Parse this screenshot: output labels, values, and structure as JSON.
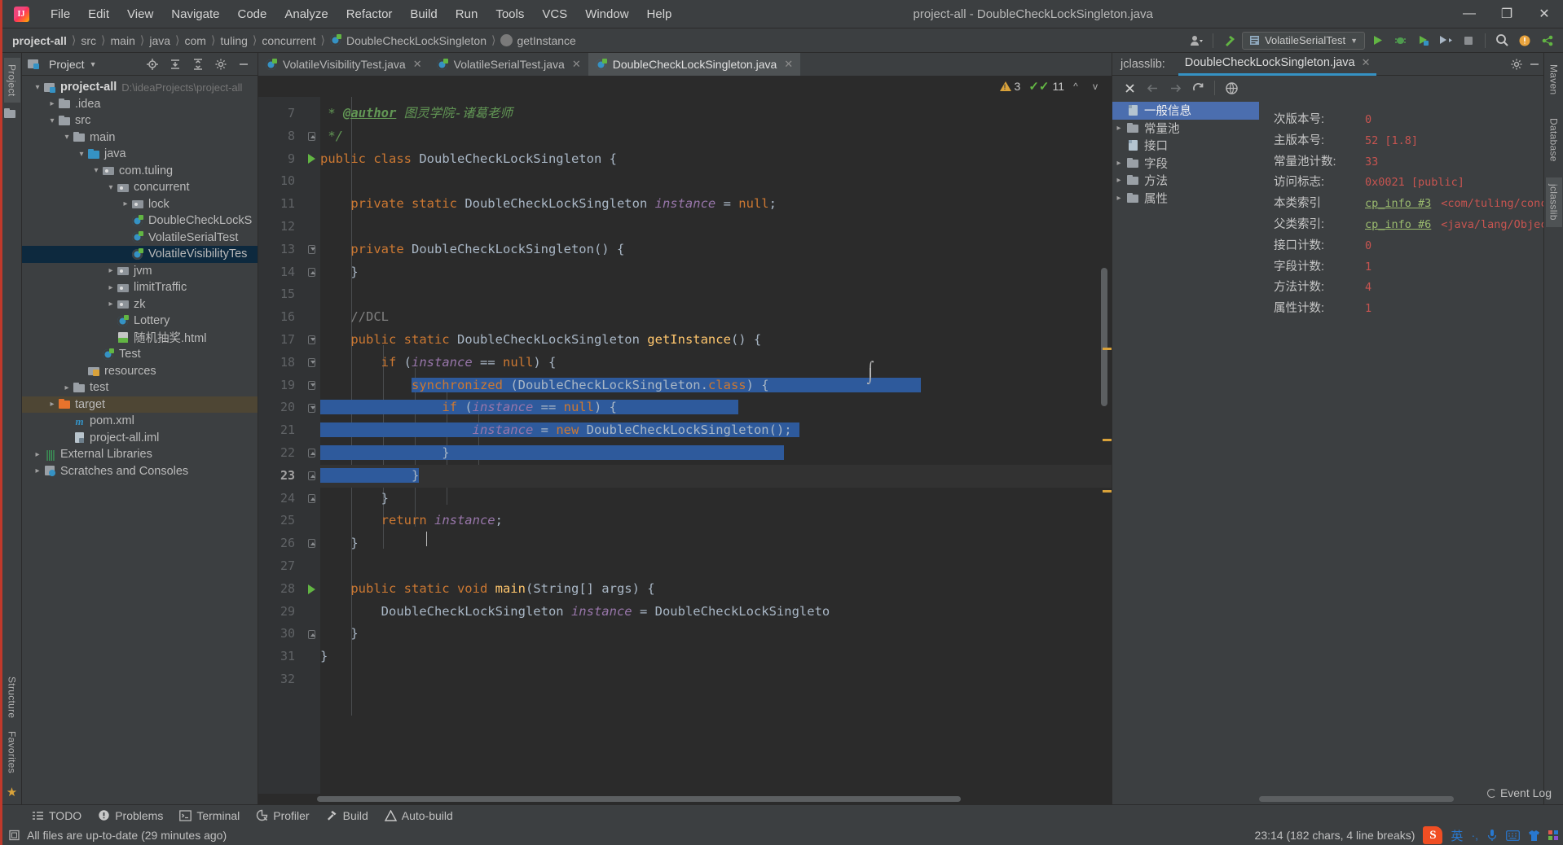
{
  "window": {
    "title": "project-all - DoubleCheckLockSingleton.java",
    "logo_text": "IJ",
    "minimize": "—",
    "maximize": "❐",
    "close": "✕"
  },
  "menubar": [
    "File",
    "Edit",
    "View",
    "Navigate",
    "Code",
    "Analyze",
    "Refactor",
    "Build",
    "Run",
    "Tools",
    "VCS",
    "Window",
    "Help"
  ],
  "breadcrumb": [
    "project-all",
    "src",
    "main",
    "java",
    "com",
    "tuling",
    "concurrent",
    "DoubleCheckLockSingleton",
    "getInstance"
  ],
  "toolbar": {
    "run_config": "VolatileSerialTest",
    "run_icon": "run-icon",
    "debug_icon": "debug-icon",
    "coverage_icon": "coverage-icon",
    "profile_icon": "profile-icon",
    "stop_icon": "stop-icon",
    "search_icon": "search-icon",
    "updates_icon": "updates-icon",
    "share_icon": "share-icon",
    "account_icon": "account-icon",
    "build_icon": "build-hammer-icon"
  },
  "left_strip": {
    "tabs": [
      "Project",
      "Structure",
      "Favorites"
    ]
  },
  "right_strip": {
    "tabs": [
      "Maven",
      "Database",
      "jclasslib"
    ]
  },
  "project_panel": {
    "title": "Project",
    "buttons": [
      "locate-icon",
      "expand-all-icon",
      "collapse-all-icon",
      "settings-icon",
      "hide-icon"
    ],
    "tree": [
      {
        "indent": 0,
        "arrow": "v",
        "icon": "project-icon",
        "label": "project-all",
        "bold": true,
        "path": "D:\\ideaProjects\\project-all"
      },
      {
        "indent": 1,
        "arrow": ">",
        "icon": "folder-icon",
        "label": ".idea"
      },
      {
        "indent": 1,
        "arrow": "v",
        "icon": "folder-icon",
        "label": "src"
      },
      {
        "indent": 2,
        "arrow": "v",
        "icon": "folder-icon",
        "label": "main"
      },
      {
        "indent": 3,
        "arrow": "v",
        "icon": "folder-blue-icon",
        "label": "java"
      },
      {
        "indent": 4,
        "arrow": "v",
        "icon": "package-icon",
        "label": "com.tuling"
      },
      {
        "indent": 5,
        "arrow": "v",
        "icon": "package-icon",
        "label": "concurrent"
      },
      {
        "indent": 6,
        "arrow": ">",
        "icon": "package-icon",
        "label": "lock"
      },
      {
        "indent": 6,
        "arrow": "",
        "icon": "java-class-icon",
        "label": "DoubleCheckLockS"
      },
      {
        "indent": 6,
        "arrow": "",
        "icon": "java-class-icon",
        "label": "VolatileSerialTest"
      },
      {
        "indent": 6,
        "arrow": "",
        "icon": "java-class-icon",
        "label": "VolatileVisibilityTes",
        "selected": true
      },
      {
        "indent": 5,
        "arrow": ">",
        "icon": "package-icon",
        "label": "jvm"
      },
      {
        "indent": 5,
        "arrow": ">",
        "icon": "package-icon",
        "label": "limitTraffic"
      },
      {
        "indent": 5,
        "arrow": ">",
        "icon": "package-icon",
        "label": "zk"
      },
      {
        "indent": 5,
        "arrow": "",
        "icon": "java-class-icon",
        "label": "Lottery"
      },
      {
        "indent": 5,
        "arrow": "",
        "icon": "html-icon",
        "label": "随机抽奖.html"
      },
      {
        "indent": 4,
        "arrow": "",
        "icon": "java-class-icon",
        "label": "Test"
      },
      {
        "indent": 3,
        "arrow": "",
        "icon": "resources-icon",
        "label": "resources"
      },
      {
        "indent": 2,
        "arrow": ">",
        "icon": "folder-icon",
        "label": "test"
      },
      {
        "indent": 1,
        "arrow": ">",
        "icon": "folder-orange-icon",
        "label": "target",
        "highlight": true
      },
      {
        "indent": 2,
        "arrow": "",
        "icon": "maven-icon",
        "label": "pom.xml"
      },
      {
        "indent": 2,
        "arrow": "",
        "icon": "iml-icon",
        "label": "project-all.iml"
      },
      {
        "indent": 0,
        "arrow": ">",
        "icon": "library-icon",
        "label": "External Libraries"
      },
      {
        "indent": 0,
        "arrow": ">",
        "icon": "scratch-icon",
        "label": "Scratches and Consoles"
      }
    ]
  },
  "editor": {
    "tabs": [
      {
        "label": "VolatileVisibilityTest.java",
        "active": false,
        "close": "✕"
      },
      {
        "label": "VolatileSerialTest.java",
        "active": false,
        "close": "✕"
      },
      {
        "label": "DoubleCheckLockSingleton.java",
        "active": true,
        "close": "✕"
      }
    ],
    "inspections": {
      "warning_icon": "warning-triangle-icon",
      "warning_count": "3",
      "check_icon": "double-check-icon",
      "check_count": "11",
      "prev_icon": "^",
      "next_icon": "v"
    },
    "first_line_number": 7,
    "current_line": 23,
    "lines": [
      {
        "n": 7,
        "fold": "",
        "run": false
      },
      {
        "n": 8,
        "fold": "up",
        "run": false
      },
      {
        "n": 9,
        "fold": "",
        "run": true
      },
      {
        "n": 10,
        "fold": "",
        "run": false
      },
      {
        "n": 11,
        "fold": "",
        "run": false
      },
      {
        "n": 12,
        "fold": "",
        "run": false
      },
      {
        "n": 13,
        "fold": "down",
        "run": false
      },
      {
        "n": 14,
        "fold": "up",
        "run": false
      },
      {
        "n": 15,
        "fold": "",
        "run": false
      },
      {
        "n": 16,
        "fold": "",
        "run": false
      },
      {
        "n": 17,
        "fold": "down",
        "run": false
      },
      {
        "n": 18,
        "fold": "down",
        "run": false
      },
      {
        "n": 19,
        "fold": "down",
        "run": false
      },
      {
        "n": 20,
        "fold": "down",
        "run": false
      },
      {
        "n": 21,
        "fold": "",
        "run": false
      },
      {
        "n": 22,
        "fold": "up",
        "run": false
      },
      {
        "n": 23,
        "fold": "up",
        "run": false
      },
      {
        "n": 24,
        "fold": "up",
        "run": false
      },
      {
        "n": 25,
        "fold": "",
        "run": false
      },
      {
        "n": 26,
        "fold": "up",
        "run": false
      },
      {
        "n": 27,
        "fold": "",
        "run": false
      },
      {
        "n": 28,
        "fold": "",
        "run": true
      },
      {
        "n": 29,
        "fold": "",
        "run": false
      },
      {
        "n": 30,
        "fold": "up",
        "run": false
      },
      {
        "n": 31,
        "fold": "",
        "run": false
      },
      {
        "n": 32,
        "fold": "",
        "run": false
      }
    ],
    "code_text": [
      " * @author 图灵学院-诸葛老师",
      " */",
      "public class DoubleCheckLockSingleton {",
      "",
      "    private static DoubleCheckLockSingleton instance = null;",
      "",
      "    private DoubleCheckLockSingleton() {",
      "    }",
      "",
      "    //DCL",
      "    public static DoubleCheckLockSingleton getInstance() {",
      "        if (instance == null) {",
      "            synchronized (DoubleCheckLockSingleton.class) {",
      "                if (instance == null) {",
      "                    instance = new DoubleCheckLockSingleton();",
      "                }",
      "            }",
      "        }",
      "        return instance;",
      "    }",
      "",
      "    public static void main(String[] args) {",
      "        DoubleCheckLockSingleton instance = DoubleCheckLockSingleto",
      "    }",
      "}",
      ""
    ]
  },
  "jclasslib": {
    "prefix_label": "jclasslib:",
    "tab_label": "DoubleCheckLockSingleton.java",
    "tab_close": "✕",
    "settings_icon": "gear-icon",
    "hide_icon": "hide-icon",
    "toolbar": [
      "close-icon",
      "back-arrow-icon",
      "forward-arrow-icon",
      "reload-icon",
      "browse-icon"
    ],
    "tree": [
      {
        "arrow": "",
        "icon": "doc-icon",
        "label": "一般信息",
        "selected": true
      },
      {
        "arrow": ">",
        "icon": "folder-icon",
        "label": "常量池"
      },
      {
        "arrow": "",
        "icon": "doc-icon",
        "label": "接口"
      },
      {
        "arrow": ">",
        "icon": "folder-icon",
        "label": "字段"
      },
      {
        "arrow": ">",
        "icon": "folder-icon",
        "label": "方法"
      },
      {
        "arrow": ">",
        "icon": "folder-icon",
        "label": "属性"
      }
    ],
    "details": [
      {
        "key": "次版本号:",
        "value": "0"
      },
      {
        "key": "主版本号:",
        "value": "52 [1.8]"
      },
      {
        "key": "常量池计数:",
        "value": "33"
      },
      {
        "key": "访问标志:",
        "value": "0x0021 [public]"
      },
      {
        "key": "本类索引",
        "link": "cp_info #3",
        "value": "<com/tuling/concurrent/Double"
      },
      {
        "key": "父类索引:",
        "link": "cp_info #6",
        "value": "<java/lang/Object>"
      },
      {
        "key": "接口计数:",
        "value": "0"
      },
      {
        "key": "字段计数:",
        "value": "1"
      },
      {
        "key": "方法计数:",
        "value": "4"
      },
      {
        "key": "属性计数:",
        "value": "1"
      }
    ]
  },
  "bottom_bar": [
    {
      "icon": "todo-icon",
      "label": "TODO"
    },
    {
      "icon": "problems-icon",
      "label": "Problems"
    },
    {
      "icon": "terminal-icon",
      "label": "Terminal"
    },
    {
      "icon": "profiler-icon",
      "label": "Profiler"
    },
    {
      "icon": "build-icon",
      "label": "Build"
    },
    {
      "icon": "auto-build-icon",
      "label": "Auto-build"
    }
  ],
  "statusbar": {
    "message_icon": "notification-icon",
    "message": "All files are up-to-date (29 minutes ago)",
    "caret_position": "23:14 (182 chars, 4 line breaks)",
    "event_log": "Event Log",
    "ime": {
      "sogou": "S",
      "mode": "英",
      "punct": "·,",
      "voice_icon": "microphone-icon",
      "keyboard_icon": "keyboard-icon",
      "skin_icon": "tshirt-icon",
      "apps_icon": "apps-icon"
    }
  },
  "colors": {
    "accent": "#3592c4",
    "selection": "#2e5a9c",
    "tree_selection": "#0d293e",
    "keyword": "#cc7832",
    "field": "#9876aa",
    "method": "#ffc66d",
    "comment": "#808080",
    "javadoc": "#629755",
    "value_red": "#c75450",
    "link_green": "#9aba6e",
    "warning": "#d9a23a",
    "ok_green": "#62b543",
    "editor_bg": "#2b2b2b",
    "panel_bg": "#3c3f41",
    "gutter_bg": "#313335"
  }
}
